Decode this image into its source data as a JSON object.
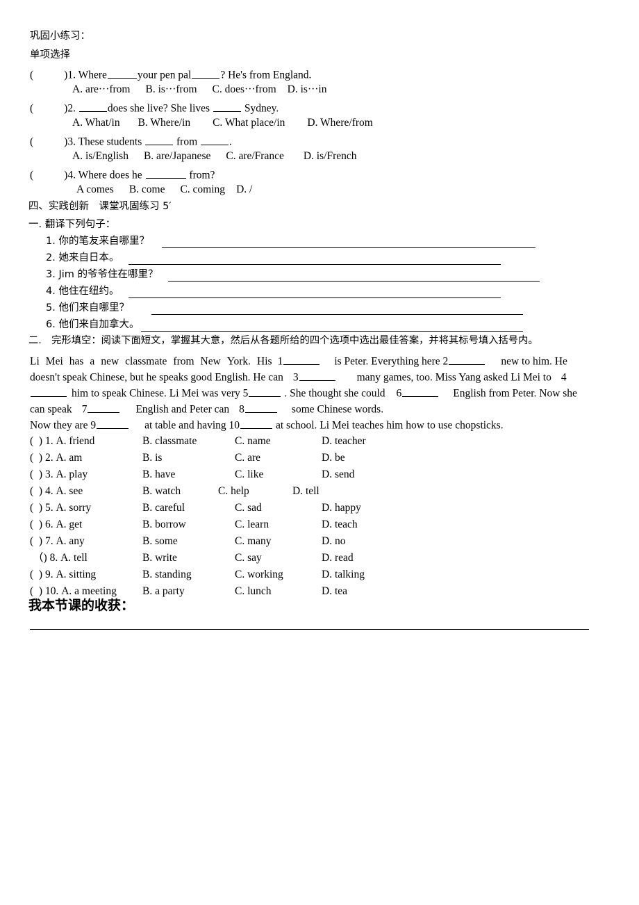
{
  "document": {
    "title_line_1": "巩固小练习：",
    "title_line_2": "单项选择"
  },
  "single_choice": {
    "questions": [
      {
        "paren": "(",
        "close_paren": ")",
        "number": "1. Where",
        "stem_mid": "your pen pal",
        "stem_end": "? He's from England.",
        "options": [
          "A. are···from",
          "B. is···from",
          "C. does···from",
          "D. is···in"
        ]
      },
      {
        "paren": "(",
        "close_paren": ")",
        "number": "2. ",
        "stem_mid": "does she live? She lives ",
        "stem_end": " Sydney.",
        "options": [
          "A. What/in",
          "B. Where/in",
          "C. What place/in",
          "D. Where/from"
        ]
      },
      {
        "paren": "(",
        "close_paren": ")",
        "number": "3. These students ",
        "stem_mid": " from ",
        "stem_end": ".",
        "options": [
          "A. is/English",
          "B. are/Japanese",
          "C. are/France",
          "D. is/French"
        ]
      },
      {
        "paren": "(",
        "close_paren": ")",
        "number": "4. Where does he ",
        "stem_mid": "",
        "stem_end": " from?",
        "options": [
          "A   comes",
          "B. come",
          "C. coming",
          "D. /"
        ]
      }
    ]
  },
  "section_four": {
    "heading": "四、实践创新　课堂巩固练习 5′"
  },
  "translation": {
    "heading": "一. 翻译下列句子：",
    "items": [
      {
        "num": "1.",
        "text": "你的笔友来自哪里？"
      },
      {
        "num": "2.",
        "text": "她来自日本。"
      },
      {
        "num": "3.",
        "text": "Jim 的爷爷住在哪里？"
      },
      {
        "num": "4.",
        "text": "他住在纽约。"
      },
      {
        "num": "5.",
        "text": "他们来自哪里？"
      },
      {
        "num": "6.",
        "text": "他们来自加拿大。"
      }
    ]
  },
  "cloze": {
    "heading": "二.　完形填空：阅读下面短文，掌握其大意，然后从各题所给的四个选项中选出最佳答案，并将其标号填入括号内。",
    "passage_lines": [
      {
        "parts": [
          "Li",
          "Mei",
          "has",
          "a",
          "new",
          "classmate",
          "from",
          "New",
          "York.",
          "His",
          "1"
        ],
        "after_blank": "is Peter. Everything here 2",
        "tail": "new to him. He"
      },
      {
        "head": "doesn't speak Chinese, but he speaks good English. He can",
        "blank_num": "3",
        "mid": "many games, too. Miss Yang asked Li Mei to",
        "tail_num": "4"
      },
      {
        "head": "",
        "mid": "him to speak Chinese. Li Mei was very 5",
        "mid2": ". She thought she could",
        "blank_num": "6",
        "tail": "English from Peter. Now she"
      },
      {
        "head": "can speak",
        "blank_num": "7",
        "mid": "English and Peter can",
        "blank_num2": "8",
        "tail": "some Chinese words."
      },
      {
        "head": "Now they are 9",
        "mid": "at table and having 10",
        "tail": "at school. Li Mei teaches him how to use chopsticks."
      }
    ],
    "options": [
      {
        "paren_open": "(",
        "paren_close": ")",
        "num": "1.",
        "a": "A. friend",
        "b": "B. classmate",
        "c": "C. name",
        "d": "D. teacher"
      },
      {
        "paren_open": "(",
        "paren_close": ")",
        "num": "2.",
        "a": "A. am",
        "b": "B. is",
        "c": "C. are",
        "d": "D. be"
      },
      {
        "paren_open": "(",
        "paren_close": ")",
        "num": "3.",
        "a": "A. play",
        "b": "B. have",
        "c": "C. like",
        "d": "D. send"
      },
      {
        "paren_open": "(",
        "paren_close": ")",
        "num": "4.",
        "a": "A. see",
        "b": "B. watch",
        "c": "C. help",
        "d": "D. tell"
      },
      {
        "paren_open": "(",
        "paren_close": ")",
        "num": "5.",
        "a": "A. sorry",
        "b": "B. careful",
        "c": "C. sad",
        "d": "D. happy"
      },
      {
        "paren_open": "(",
        "paren_close": ")",
        "num": "6.",
        "a": "A. get",
        "b": "B. borrow",
        "c": "C. learn",
        "d": "D. teach"
      },
      {
        "paren_open": "(",
        "paren_close": ")",
        "num": "7.",
        "a": "A. any",
        "b": "B. some",
        "c": "C. many",
        "d": "D. no"
      },
      {
        "paren_open": "（",
        "paren_close": ")",
        "num": "8.",
        "a": "A. tell",
        "b": "B. write",
        "c": "C. say",
        "d": "D. read"
      },
      {
        "paren_open": "(",
        "paren_close": ")",
        "num": "9.",
        "a": "A. sitting",
        "b": "B. standing",
        "c": "C. working",
        "d": "D. talking"
      },
      {
        "paren_open": "(",
        "paren_close": ")",
        "num": "10.",
        "a": "A. a meeting",
        "b": "B. a party",
        "c": "C. lunch",
        "d": "D. tea"
      }
    ]
  },
  "reflection": {
    "heading": "我本节课的收获："
  }
}
